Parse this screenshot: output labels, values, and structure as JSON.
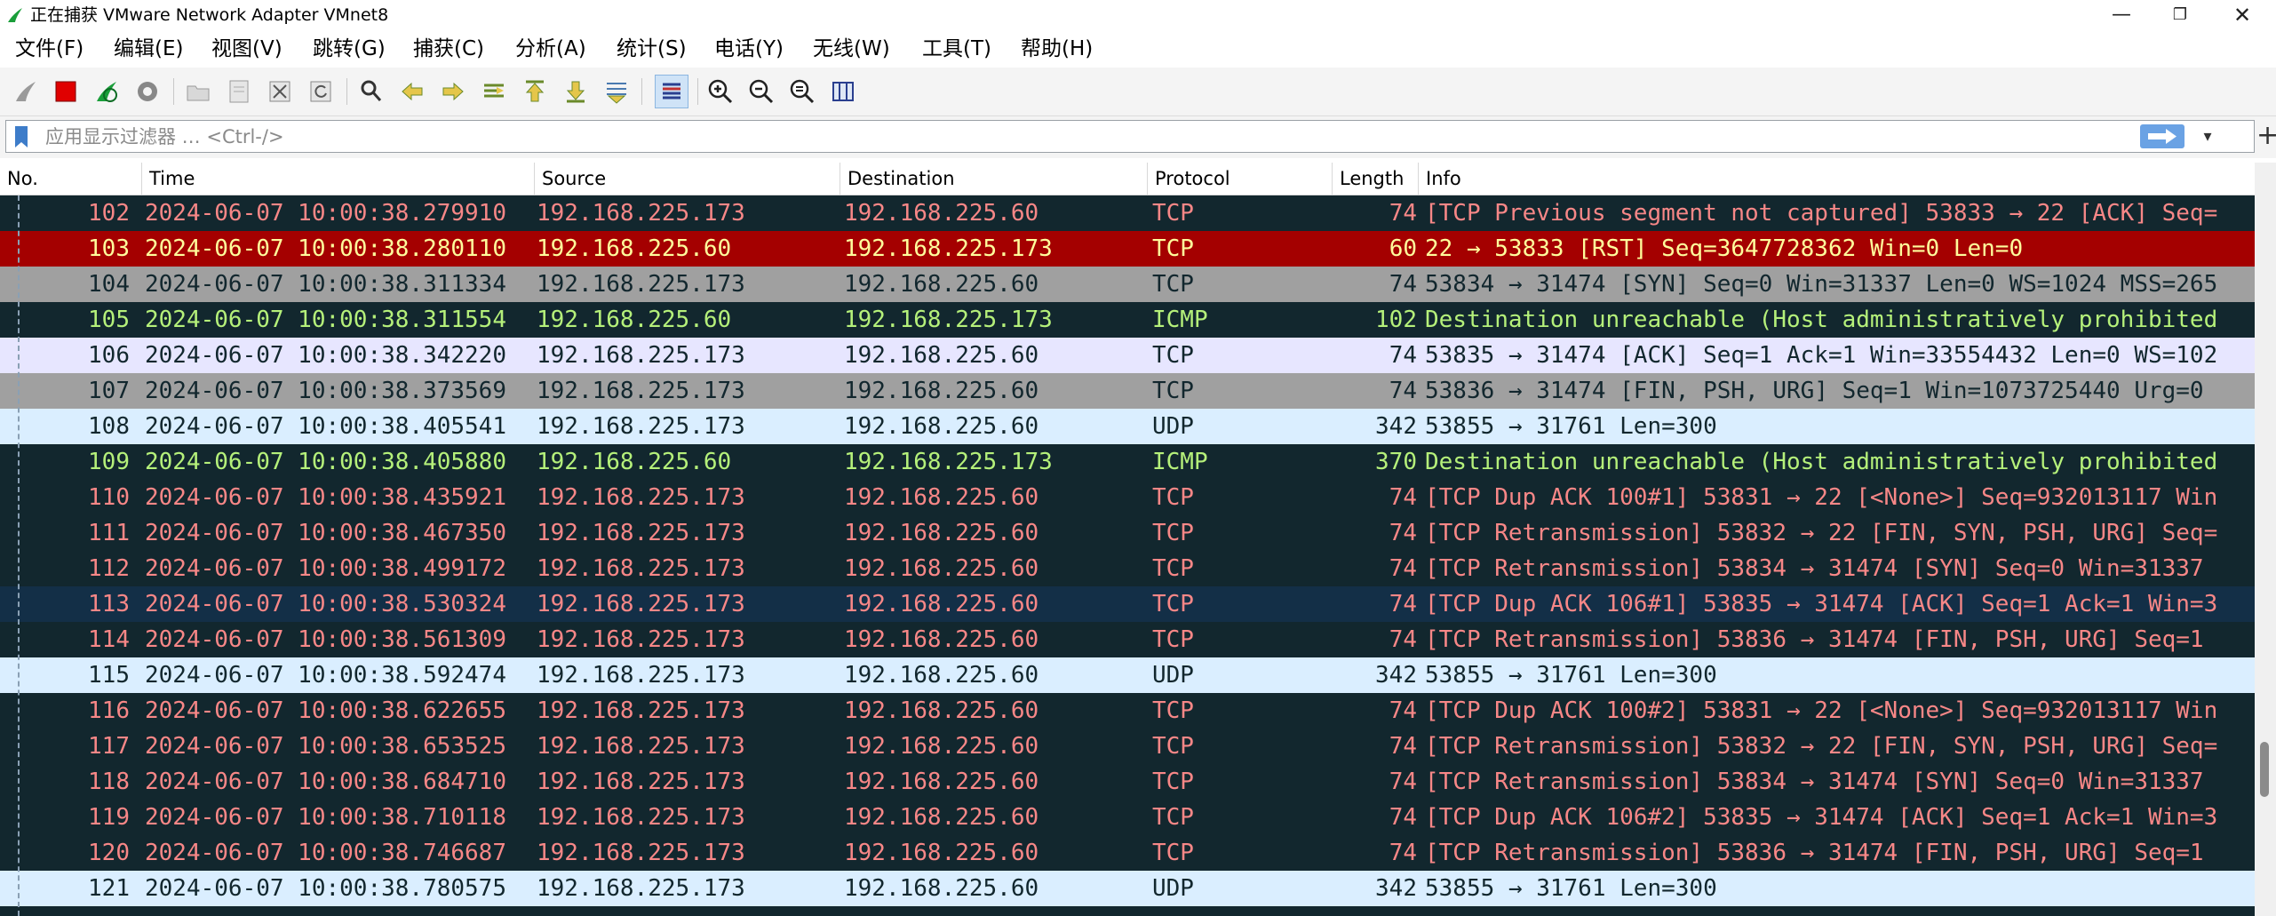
{
  "window": {
    "title": "正在捕获 VMware Network Adapter VMnet8",
    "minimize": "—",
    "maximize": "❐",
    "close": "✕"
  },
  "menu": [
    {
      "label": "文件(F)"
    },
    {
      "label": "编辑(E)"
    },
    {
      "label": "视图(V)"
    },
    {
      "label": "跳转(G)"
    },
    {
      "label": "捕获(C)"
    },
    {
      "label": "分析(A)"
    },
    {
      "label": "统计(S)"
    },
    {
      "label": "电话(Y)"
    },
    {
      "label": "无线(W)"
    },
    {
      "label": "工具(T)"
    },
    {
      "label": "帮助(H)"
    }
  ],
  "toolbar": [
    "start-capture-icon",
    "stop-capture-icon",
    "restart-capture-icon",
    "capture-options-icon",
    "open-file-icon",
    "save-file-icon",
    "close-file-icon",
    "reload-file-icon",
    "find-packet-icon",
    "go-back-icon",
    "go-forward-icon",
    "go-to-packet-icon",
    "go-first-icon",
    "go-last-icon",
    "autoscroll-icon",
    "colorize-icon",
    "zoom-in-icon",
    "zoom-out-icon",
    "zoom-normal-icon",
    "resize-columns-icon"
  ],
  "filter": {
    "placeholder": "应用显示过滤器 … <Ctrl-/>"
  },
  "columns": {
    "no": "No.",
    "time": "Time",
    "source": "Source",
    "destination": "Destination",
    "protocol": "Protocol",
    "length": "Length",
    "info": "Info"
  },
  "colors": {
    "dark_bg": "#12272e",
    "red_fg": "#f78787",
    "green_fg": "#b5f07a",
    "rst_bg": "#a40000",
    "rst_fg": "#fffc9c",
    "gray_bg": "#a0a0a0",
    "udp_bg": "#daeeff",
    "lav_bg": "#e7e6ff",
    "sel_bg": "#132f47"
  },
  "packets": [
    {
      "no": "102",
      "time": "2024-06-07 10:00:38.279910",
      "src": "192.168.225.173",
      "dst": "192.168.225.60",
      "proto": "TCP",
      "len": "74",
      "info": "[TCP Previous segment not captured] 53833 → 22 [ACK] Seq=",
      "bg": "#12272e",
      "fg": "#f78787"
    },
    {
      "no": "103",
      "time": "2024-06-07 10:00:38.280110",
      "src": "192.168.225.60",
      "dst": "192.168.225.173",
      "proto": "TCP",
      "len": "60",
      "info": "22 → 53833 [RST] Seq=3647728362 Win=0 Len=0",
      "bg": "#a40000",
      "fg": "#fffc9c"
    },
    {
      "no": "104",
      "time": "2024-06-07 10:00:38.311334",
      "src": "192.168.225.173",
      "dst": "192.168.225.60",
      "proto": "TCP",
      "len": "74",
      "info": "53834 → 31474 [SYN] Seq=0 Win=31337 Len=0 WS=1024 MSS=265",
      "bg": "#a0a0a0",
      "fg": "#12272e"
    },
    {
      "no": "105",
      "time": "2024-06-07 10:00:38.311554",
      "src": "192.168.225.60",
      "dst": "192.168.225.173",
      "proto": "ICMP",
      "len": "102",
      "info": "Destination unreachable (Host administratively prohibited",
      "bg": "#12272e",
      "fg": "#b5f07a"
    },
    {
      "no": "106",
      "time": "2024-06-07 10:00:38.342220",
      "src": "192.168.225.173",
      "dst": "192.168.225.60",
      "proto": "TCP",
      "len": "74",
      "info": "53835 → 31474 [ACK] Seq=1 Ack=1 Win=33554432 Len=0 WS=102",
      "bg": "#e7e6ff",
      "fg": "#12272e"
    },
    {
      "no": "107",
      "time": "2024-06-07 10:00:38.373569",
      "src": "192.168.225.173",
      "dst": "192.168.225.60",
      "proto": "TCP",
      "len": "74",
      "info": "53836 → 31474 [FIN, PSH, URG] Seq=1 Win=1073725440 Urg=0",
      "bg": "#a0a0a0",
      "fg": "#12272e"
    },
    {
      "no": "108",
      "time": "2024-06-07 10:00:38.405541",
      "src": "192.168.225.173",
      "dst": "192.168.225.60",
      "proto": "UDP",
      "len": "342",
      "info": "53855 → 31761 Len=300",
      "bg": "#daeeff",
      "fg": "#12272e"
    },
    {
      "no": "109",
      "time": "2024-06-07 10:00:38.405880",
      "src": "192.168.225.60",
      "dst": "192.168.225.173",
      "proto": "ICMP",
      "len": "370",
      "info": "Destination unreachable (Host administratively prohibited",
      "bg": "#12272e",
      "fg": "#b5f07a"
    },
    {
      "no": "110",
      "time": "2024-06-07 10:00:38.435921",
      "src": "192.168.225.173",
      "dst": "192.168.225.60",
      "proto": "TCP",
      "len": "74",
      "info": "[TCP Dup ACK 100#1] 53831 → 22 [<None>] Seq=932013117 Win",
      "bg": "#12272e",
      "fg": "#f78787"
    },
    {
      "no": "111",
      "time": "2024-06-07 10:00:38.467350",
      "src": "192.168.225.173",
      "dst": "192.168.225.60",
      "proto": "TCP",
      "len": "74",
      "info": "[TCP Retransmission] 53832 → 22 [FIN, SYN, PSH, URG] Seq=",
      "bg": "#12272e",
      "fg": "#f78787"
    },
    {
      "no": "112",
      "time": "2024-06-07 10:00:38.499172",
      "src": "192.168.225.173",
      "dst": "192.168.225.60",
      "proto": "TCP",
      "len": "74",
      "info": "[TCP Retransmission] 53834 → 31474 [SYN] Seq=0 Win=31337",
      "bg": "#12272e",
      "fg": "#f78787"
    },
    {
      "no": "113",
      "time": "2024-06-07 10:00:38.530324",
      "src": "192.168.225.173",
      "dst": "192.168.225.60",
      "proto": "TCP",
      "len": "74",
      "info": "[TCP Dup ACK 106#1] 53835 → 31474 [ACK] Seq=1 Ack=1 Win=3",
      "bg": "#132f47",
      "fg": "#f78787"
    },
    {
      "no": "114",
      "time": "2024-06-07 10:00:38.561309",
      "src": "192.168.225.173",
      "dst": "192.168.225.60",
      "proto": "TCP",
      "len": "74",
      "info": "[TCP Retransmission] 53836 → 31474 [FIN, PSH, URG] Seq=1",
      "bg": "#12272e",
      "fg": "#f78787"
    },
    {
      "no": "115",
      "time": "2024-06-07 10:00:38.592474",
      "src": "192.168.225.173",
      "dst": "192.168.225.60",
      "proto": "UDP",
      "len": "342",
      "info": "53855 → 31761 Len=300",
      "bg": "#daeeff",
      "fg": "#12272e"
    },
    {
      "no": "116",
      "time": "2024-06-07 10:00:38.622655",
      "src": "192.168.225.173",
      "dst": "192.168.225.60",
      "proto": "TCP",
      "len": "74",
      "info": "[TCP Dup ACK 100#2] 53831 → 22 [<None>] Seq=932013117 Win",
      "bg": "#12272e",
      "fg": "#f78787"
    },
    {
      "no": "117",
      "time": "2024-06-07 10:00:38.653525",
      "src": "192.168.225.173",
      "dst": "192.168.225.60",
      "proto": "TCP",
      "len": "74",
      "info": "[TCP Retransmission] 53832 → 22 [FIN, SYN, PSH, URG] Seq=",
      "bg": "#12272e",
      "fg": "#f78787"
    },
    {
      "no": "118",
      "time": "2024-06-07 10:00:38.684710",
      "src": "192.168.225.173",
      "dst": "192.168.225.60",
      "proto": "TCP",
      "len": "74",
      "info": "[TCP Retransmission] 53834 → 31474 [SYN] Seq=0 Win=31337",
      "bg": "#12272e",
      "fg": "#f78787"
    },
    {
      "no": "119",
      "time": "2024-06-07 10:00:38.710118",
      "src": "192.168.225.173",
      "dst": "192.168.225.60",
      "proto": "TCP",
      "len": "74",
      "info": "[TCP Dup ACK 106#2] 53835 → 31474 [ACK] Seq=1 Ack=1 Win=3",
      "bg": "#12272e",
      "fg": "#f78787"
    },
    {
      "no": "120",
      "time": "2024-06-07 10:00:38.746687",
      "src": "192.168.225.173",
      "dst": "192.168.225.60",
      "proto": "TCP",
      "len": "74",
      "info": "[TCP Retransmission] 53836 → 31474 [FIN, PSH, URG] Seq=1",
      "bg": "#12272e",
      "fg": "#f78787"
    },
    {
      "no": "121",
      "time": "2024-06-07 10:00:38.780575",
      "src": "192.168.225.173",
      "dst": "192.168.225.60",
      "proto": "UDP",
      "len": "342",
      "info": "53855 → 31761 Len=300",
      "bg": "#daeeff",
      "fg": "#12272e"
    }
  ]
}
